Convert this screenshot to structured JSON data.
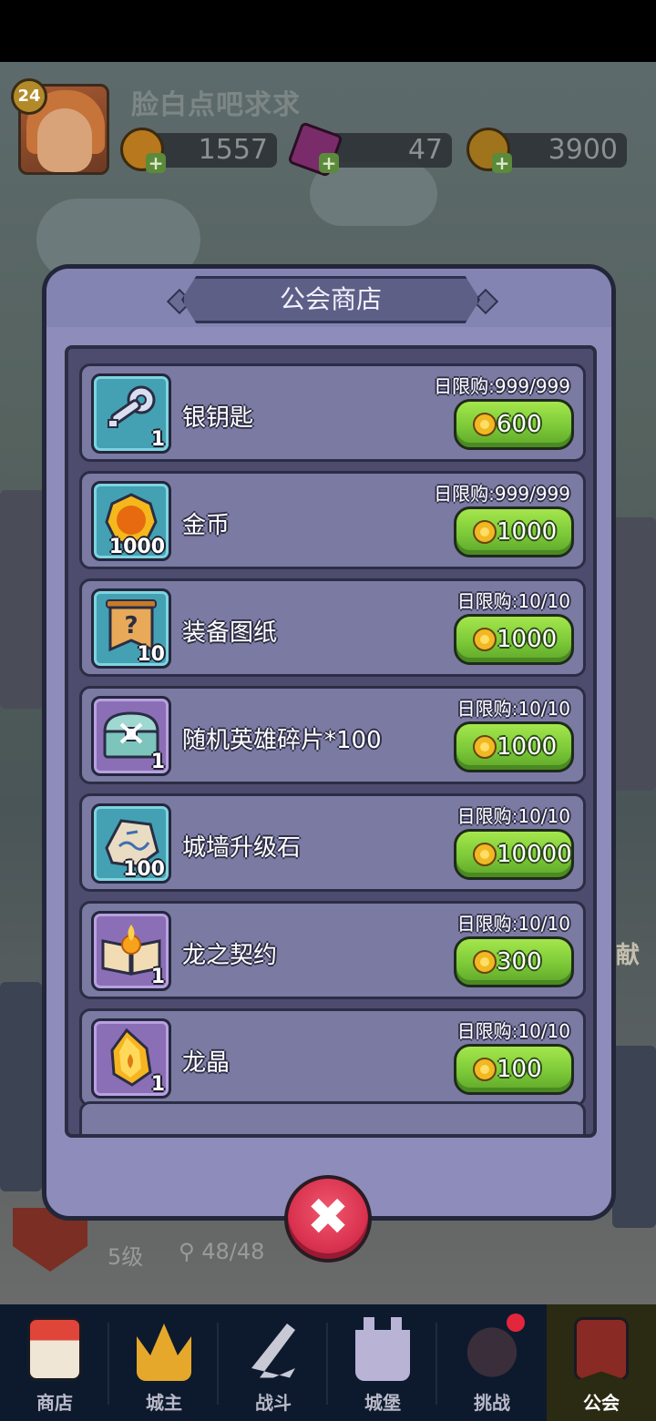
{
  "player": {
    "level": "24",
    "name": "脸白点吧求求",
    "currencies": [
      {
        "icon": "gold-coin-icon",
        "value": "1557"
      },
      {
        "icon": "purple-gem-icon",
        "value": "47"
      },
      {
        "icon": "guild-coin-icon",
        "value": "3900"
      }
    ]
  },
  "background": {
    "guild_level": "5级",
    "guild_members": "48/48",
    "side_label": "献"
  },
  "shop": {
    "title": "公会商店",
    "items": [
      {
        "name": "银钥匙",
        "qty": "1",
        "limit": "日限购:999/999",
        "price": "600",
        "icon": "silver-key-icon",
        "frame": "teal"
      },
      {
        "name": "金币",
        "qty": "1000",
        "limit": "日限购:999/999",
        "price": "1000",
        "icon": "gold-coin-icon",
        "frame": "teal"
      },
      {
        "name": "装备图纸",
        "qty": "10",
        "limit": "日限购:10/10",
        "price": "1000",
        "icon": "blueprint-scroll-icon",
        "frame": "teal"
      },
      {
        "name": "随机英雄碎片*100",
        "qty": "1",
        "limit": "日限购:10/10",
        "price": "1000",
        "icon": "treasure-chest-icon",
        "frame": "purple"
      },
      {
        "name": "城墙升级石",
        "qty": "100",
        "limit": "日限购:10/10",
        "price": "10000",
        "icon": "rune-stone-icon",
        "frame": "teal"
      },
      {
        "name": "龙之契约",
        "qty": "1",
        "limit": "日限购:10/10",
        "price": "300",
        "icon": "magic-book-icon",
        "frame": "purple"
      },
      {
        "name": "龙晶",
        "qty": "1",
        "limit": "日限购:10/10",
        "price": "100",
        "icon": "dragon-crystal-icon",
        "frame": "purple"
      }
    ]
  },
  "nav": [
    {
      "label": "商店",
      "icon": "shop-icon",
      "active": false
    },
    {
      "label": "城主",
      "icon": "crown-icon",
      "active": false
    },
    {
      "label": "战斗",
      "icon": "swords-icon",
      "active": false
    },
    {
      "label": "城堡",
      "icon": "castle-icon",
      "active": false
    },
    {
      "label": "挑战",
      "icon": "demon-icon",
      "active": false
    },
    {
      "label": "公会",
      "icon": "guild-banner-icon",
      "active": true
    }
  ],
  "colors": {
    "dialog_bg": "#8d8cba",
    "item_bg": "#7b7aa3",
    "buy_green": "#7cc938",
    "close_red": "#d9324f",
    "nav_bg": "#0d1a2e"
  }
}
